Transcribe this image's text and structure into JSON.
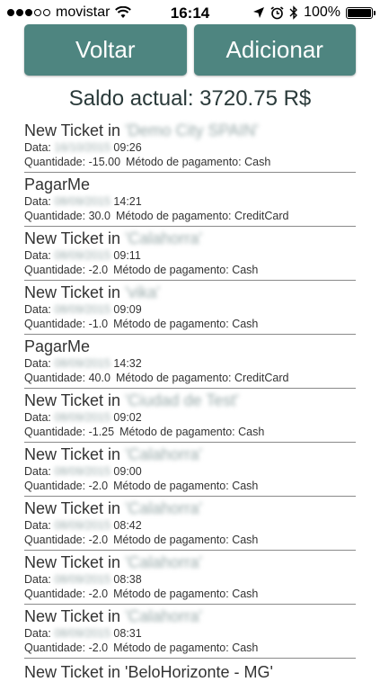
{
  "status_bar": {
    "carrier": "movistar",
    "time": "16:14",
    "battery": "100%"
  },
  "buttons": {
    "back_label": "Voltar",
    "add_label": "Adicionar"
  },
  "balance": {
    "text": "Saldo actual: 3720.75 R$"
  },
  "labels": {
    "date": "Data:",
    "quantity": "Quantidade:",
    "method": "Método de pagamento:"
  },
  "tickets": [
    {
      "title": "New Ticket in",
      "place": "'Demo City SPAIN'",
      "date": "16/10/2015",
      "time": "09:26",
      "quantity": "-15.00",
      "method": "Cash"
    },
    {
      "title": "PagarMe",
      "place": "",
      "date": "08/09/2015",
      "time": "14:21",
      "quantity": "30.0",
      "method": "CreditCard"
    },
    {
      "title": "New Ticket in",
      "place": "'Calahorra'",
      "date": "08/09/2015",
      "time": "09:11",
      "quantity": "-2.0",
      "method": "Cash"
    },
    {
      "title": "New Ticket in",
      "place": "'vika'",
      "date": "08/09/2015",
      "time": "09:09",
      "quantity": "-1.0",
      "method": "Cash"
    },
    {
      "title": "PagarMe",
      "place": "",
      "date": "08/09/2015",
      "time": "14:32",
      "quantity": "40.0",
      "method": "CreditCard"
    },
    {
      "title": "New Ticket in",
      "place": "'Ciudad de Test'",
      "date": "08/09/2015",
      "time": "09:02",
      "quantity": "-1.25",
      "method": "Cash"
    },
    {
      "title": "New Ticket in",
      "place": "'Calahorra'",
      "date": "08/09/2015",
      "time": "09:00",
      "quantity": "-2.0",
      "method": "Cash"
    },
    {
      "title": "New Ticket in",
      "place": "'Calahorra'",
      "date": "08/09/2015",
      "time": "08:42",
      "quantity": "-2.0",
      "method": "Cash"
    },
    {
      "title": "New Ticket in",
      "place": "'Calahorra'",
      "date": "08/09/2015",
      "time": "08:38",
      "quantity": "-2.0",
      "method": "Cash"
    },
    {
      "title": "New Ticket in",
      "place": "'Calahorra'",
      "date": "08/09/2015",
      "time": "08:31",
      "quantity": "-2.0",
      "method": "Cash"
    }
  ],
  "cutoff_item": {
    "text": "New Ticket in 'BeloHorizonte - MG'"
  }
}
